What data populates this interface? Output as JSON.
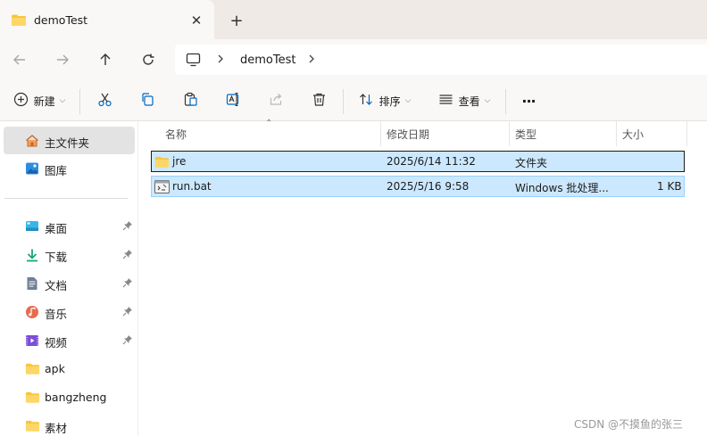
{
  "window": {
    "tab_title": "demoTest",
    "close_glyph": "✕",
    "new_tab_glyph": "+"
  },
  "address": {
    "path": "demoTest"
  },
  "toolbar": {
    "new_label": "新建",
    "sort_label": "排序",
    "view_label": "查看",
    "more_glyph": "···"
  },
  "sidebar": {
    "items": [
      {
        "label": "主文件夹",
        "icon": "home-icon",
        "selected": true
      },
      {
        "label": "图库",
        "icon": "gallery-icon"
      },
      {
        "label": "桌面",
        "icon": "desktop-icon",
        "pinned": true
      },
      {
        "label": "下载",
        "icon": "download-icon",
        "pinned": true
      },
      {
        "label": "文档",
        "icon": "document-icon",
        "pinned": true
      },
      {
        "label": "音乐",
        "icon": "music-icon",
        "pinned": true
      },
      {
        "label": "视频",
        "icon": "video-icon",
        "pinned": true
      },
      {
        "label": "apk",
        "icon": "folder-icon"
      },
      {
        "label": "bangzheng",
        "icon": "folder-icon"
      },
      {
        "label": "素材",
        "icon": "folder-icon"
      }
    ]
  },
  "list": {
    "columns": [
      "名称",
      "修改日期",
      "类型",
      "大小"
    ],
    "rows": [
      {
        "name": "jre",
        "modified": "2025/6/14 11:32",
        "type": "文件夹",
        "size": "",
        "icon": "folder-icon"
      },
      {
        "name": "run.bat",
        "modified": "2025/5/16 9:58",
        "type": "Windows 批处理...",
        "size": "1 KB",
        "icon": "bat-file-icon"
      }
    ]
  },
  "watermark": "CSDN @不摸鱼的张三",
  "colors": {
    "selection": "#cce8ff",
    "folder": "#f8c63d",
    "accent": "#0067c0"
  }
}
